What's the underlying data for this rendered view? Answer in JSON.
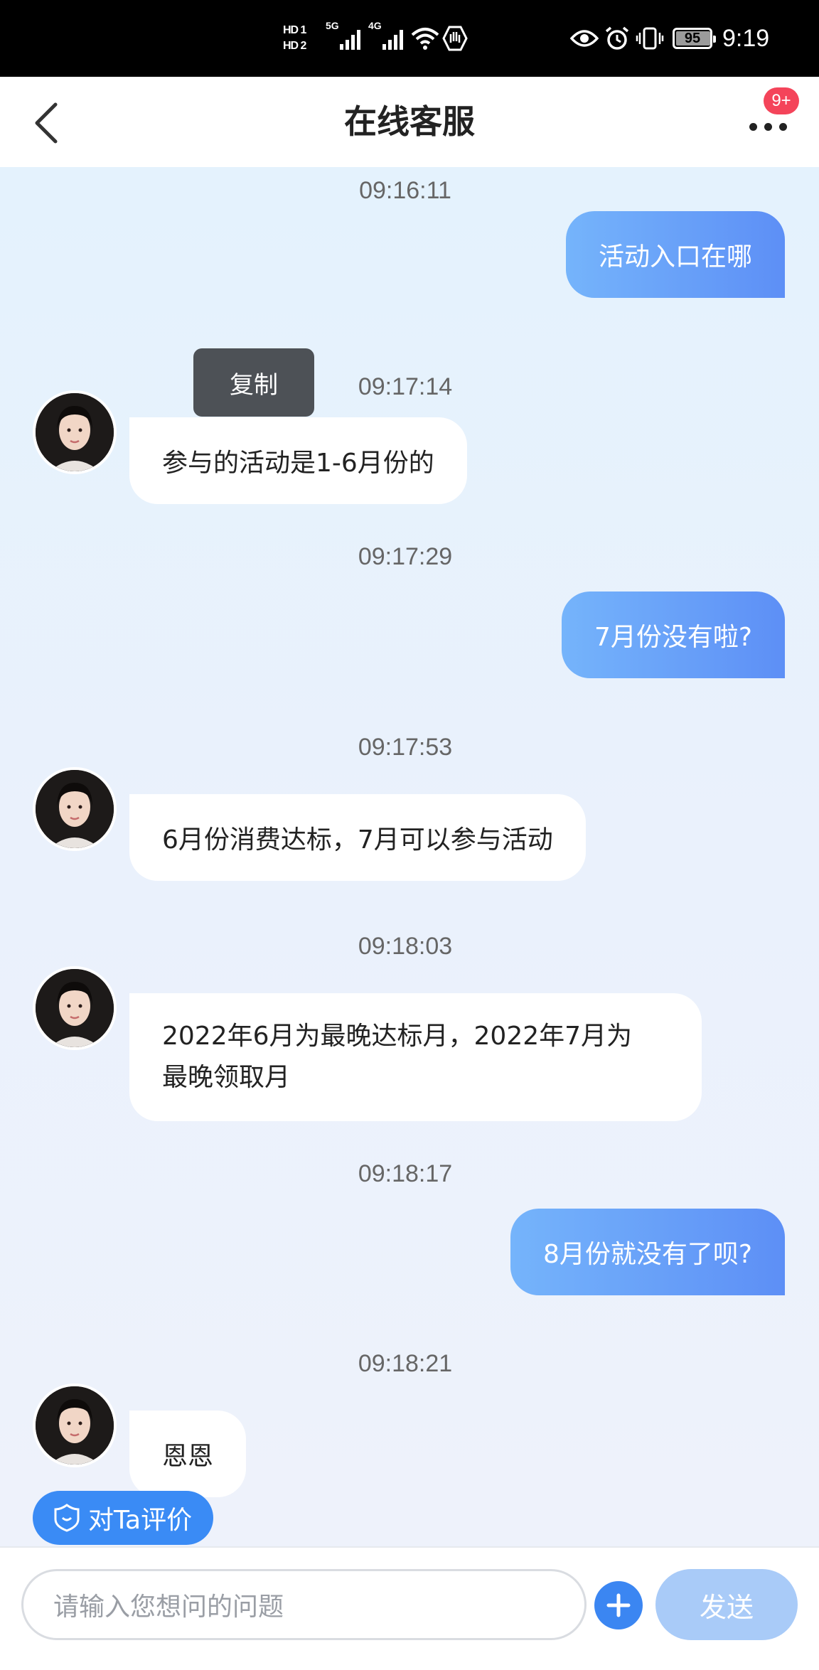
{
  "status_bar": {
    "hd1": "HD 1",
    "hd2": "HD 2",
    "net1": "5G",
    "net2": "4G",
    "battery": "95",
    "time": "9:19"
  },
  "header": {
    "title": "在线客服",
    "badge": "9+"
  },
  "popup": {
    "copy_label": "复制"
  },
  "messages": [
    {
      "time": "09:16:11",
      "from": "user",
      "text": "活动入口在哪"
    },
    {
      "time": "09:17:14",
      "from": "agent",
      "text": "参与的活动是1-6月份的"
    },
    {
      "time": "09:17:29",
      "from": "user",
      "text": "7月份没有啦?"
    },
    {
      "time": "09:17:53",
      "from": "agent",
      "text": "6月份消费达标，7月可以参与活动"
    },
    {
      "time": "09:18:03",
      "from": "agent",
      "lines": [
        "2022年6月为最晚达标月，2022年7月为",
        "最晚领取月"
      ]
    },
    {
      "time": "09:18:17",
      "from": "user",
      "text": "8月份就没有了呗?"
    },
    {
      "time": "09:18:21",
      "from": "agent",
      "text": "恩恩"
    }
  ],
  "rate_button": {
    "label": "对Ta评价"
  },
  "input": {
    "placeholder": "请输入您想问的问题",
    "send_label": "发送"
  },
  "colors": {
    "user_bubble_start": "#75b4fb",
    "user_bubble_end": "#5d8ff6",
    "accent": "#3b86f2",
    "badge": "#f4445a",
    "send_disabled": "#a9cbf8"
  }
}
